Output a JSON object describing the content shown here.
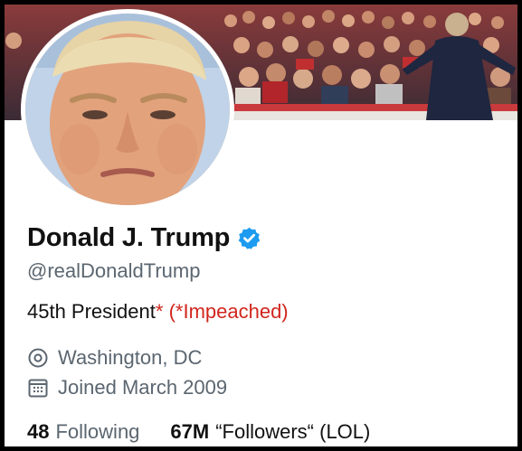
{
  "profile": {
    "display_name": "Donald J. Trump",
    "handle": "@realDonaldTrump",
    "bio_main": "45th President",
    "bio_star": "*",
    "bio_note": "(*Impeached)",
    "location": "Washington, DC",
    "joined": "Joined March 2009",
    "following_count": "48",
    "following_label": "Following",
    "followers_count": "67M",
    "followers_label": "“Followers“ (LOL)"
  },
  "icons": {
    "verified": "verified-badge-icon",
    "location": "location-pin-icon",
    "calendar": "calendar-icon"
  },
  "colors": {
    "verified_blue": "#1d9bf0",
    "name_text": "#111111",
    "secondary_text": "#5b6670",
    "impeached_red": "#d1261d",
    "background": "#ffffff"
  }
}
